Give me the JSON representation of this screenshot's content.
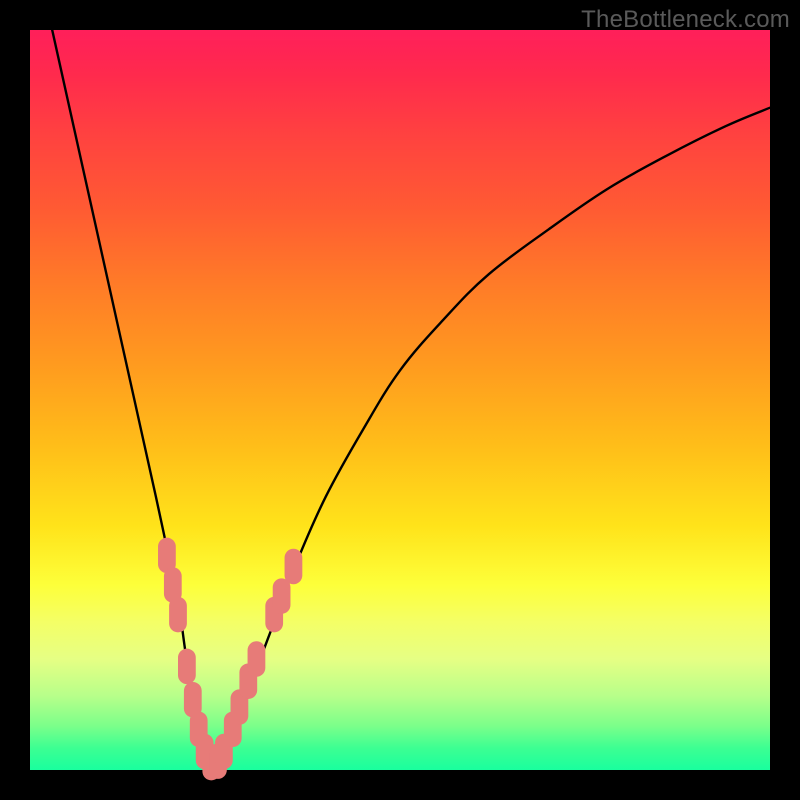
{
  "watermark": "TheBottleneck.com",
  "colors": {
    "frame": "#000000",
    "marker": "#e77b78",
    "line": "#000000"
  },
  "chart_data": {
    "type": "line",
    "title": "",
    "xlabel": "",
    "ylabel": "",
    "xlim": [
      0,
      100
    ],
    "ylim": [
      0,
      100
    ],
    "grid": false,
    "legend": false,
    "series": [
      {
        "name": "bottleneck-curve",
        "x": [
          3,
          5,
          7,
          9,
          11,
          13,
          15,
          17,
          18.5,
          20,
          21,
          22,
          23,
          24,
          25,
          26,
          28,
          30,
          33,
          36,
          40,
          45,
          50,
          56,
          62,
          70,
          78,
          86,
          94,
          100
        ],
        "y": [
          100,
          91,
          82,
          73,
          64,
          55,
          46,
          37,
          30,
          23,
          16,
          10,
          5,
          2,
          1,
          2,
          6,
          12,
          20,
          28,
          37,
          46,
          54,
          61,
          67,
          73,
          78.5,
          83,
          87,
          89.5
        ]
      }
    ],
    "markers": [
      {
        "x": 18.5,
        "y": 29
      },
      {
        "x": 19.3,
        "y": 25
      },
      {
        "x": 20.0,
        "y": 21
      },
      {
        "x": 21.2,
        "y": 14
      },
      {
        "x": 22.0,
        "y": 9.5
      },
      {
        "x": 22.8,
        "y": 5.5
      },
      {
        "x": 23.6,
        "y": 2.5
      },
      {
        "x": 24.5,
        "y": 1.0
      },
      {
        "x": 25.4,
        "y": 1.2
      },
      {
        "x": 26.2,
        "y": 2.5
      },
      {
        "x": 27.4,
        "y": 5.5
      },
      {
        "x": 28.3,
        "y": 8.5
      },
      {
        "x": 29.5,
        "y": 12
      },
      {
        "x": 30.6,
        "y": 15
      },
      {
        "x": 33.0,
        "y": 21
      },
      {
        "x": 34.0,
        "y": 23.5
      },
      {
        "x": 35.6,
        "y": 27.5
      }
    ],
    "marker_style": {
      "shape": "rounded-rect",
      "w": 2.4,
      "h": 4.8,
      "rx": 1.2
    }
  }
}
